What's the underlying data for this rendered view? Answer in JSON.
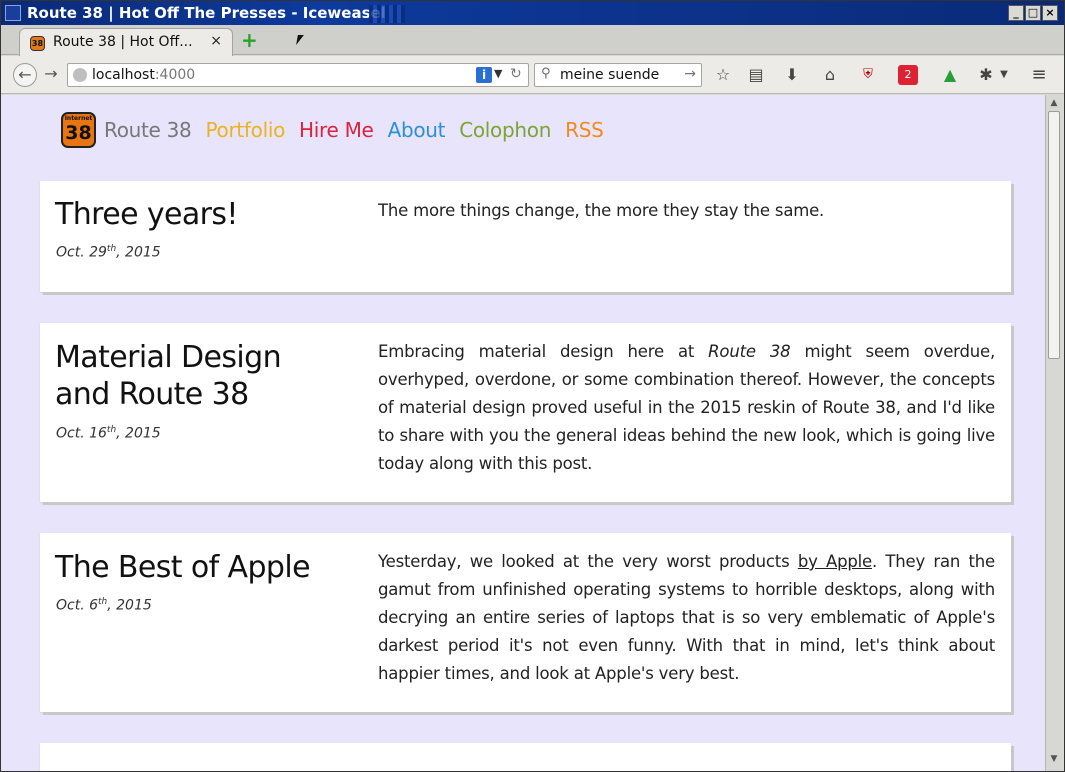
{
  "window": {
    "title": "Route 38 | Hot Off The Presses - Iceweasel",
    "minimize": "_",
    "maximize": "□",
    "close": "×"
  },
  "tabs": [
    {
      "favicon": "38",
      "title": "Route 38 | Hot Off...",
      "close": "×"
    }
  ],
  "new_tab": "+",
  "navbar": {
    "back": "←",
    "forward": "→",
    "url_host": "localhost",
    "url_port": ":4000",
    "search_value": "meine suende",
    "icons": [
      "star-icon",
      "reading-list-icon",
      "download-icon",
      "home-icon",
      "ublock-icon",
      "addon-badge-icon",
      "drive-icon",
      "bug-icon",
      "menu-icon"
    ],
    "addon_badge": "2"
  },
  "site": {
    "logo_top": "Internet",
    "logo_num": "38",
    "nav": {
      "brand": "Route 38",
      "portfolio": "Portfolio",
      "hire": "Hire Me",
      "about": "About",
      "colophon": "Colophon",
      "rss": "RSS"
    }
  },
  "posts": [
    {
      "title": "Three years!",
      "date_pre": "Oct. 29",
      "date_sup": "th",
      "date_post": ", 2015",
      "excerpt": "The more things change, the more they stay the same."
    },
    {
      "title_line1": "Material Design",
      "title_line2": "and Route 38",
      "date_pre": "Oct. 16",
      "date_sup": "th",
      "date_post": ", 2015",
      "excerpt_a": "Embracing material design here at ",
      "excerpt_em": "Route 38",
      "excerpt_b": " might seem overdue, overhyped, overdone, or some combination thereof. However, the concepts of material design proved useful in the 2015 reskin of Route 38, and I'd like to share with you the general ideas behind the new look, which is going live today along with this post."
    },
    {
      "title": "The Best of Apple",
      "date_pre": "Oct. 6",
      "date_sup": "th",
      "date_post": ", 2015",
      "excerpt_a": "Yesterday, we looked at the very worst products ",
      "excerpt_link": "by Apple",
      "excerpt_b": ". They ran the gamut from unfinished operating systems to horrible desktops, along with decrying an entire series of laptops that is so very emblematic of Apple's darkest period it's not even funny. With that in mind, let's think about happier times, and look at Apple's very best."
    }
  ]
}
